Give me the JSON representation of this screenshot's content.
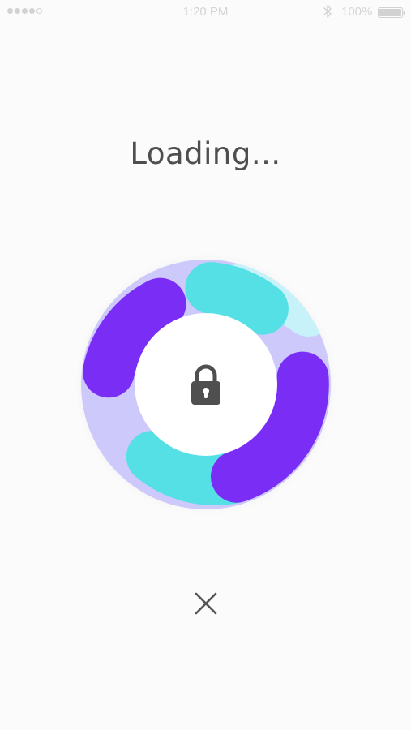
{
  "status_bar": {
    "signal_bars": 5,
    "signal_filled": 4,
    "time": "1:20 PM",
    "bluetooth_icon": "bluetooth-icon",
    "battery_percent": "100%",
    "battery_icon": "battery-full-icon"
  },
  "loading": {
    "title": "Loading..."
  },
  "spinner": {
    "center_icon": "lock-icon",
    "colors": {
      "purple": "#7a2df5",
      "cyan": "#55e0e5",
      "lavender": "#cec9fb",
      "light_cyan": "#c7f2fa",
      "center": "#ffffff",
      "lock": "#4f4f4f"
    }
  },
  "actions": {
    "close_icon": "close-icon"
  }
}
